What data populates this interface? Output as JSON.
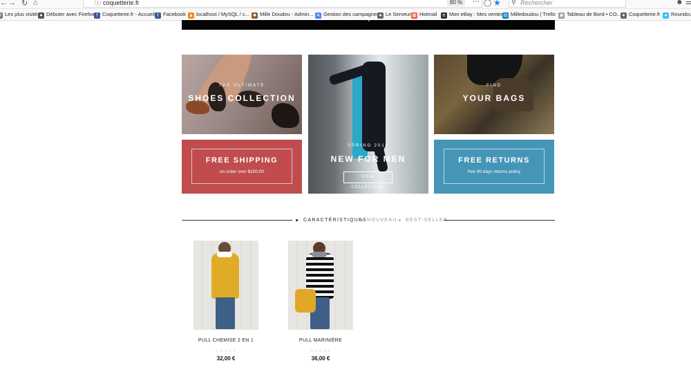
{
  "browser": {
    "url": "coquetterie.fr",
    "zoom": "80 %",
    "search_placeholder": "Rechercher",
    "bookmarks": [
      {
        "label": "Les plus visités",
        "icon": "gear-icon",
        "color": "#777777"
      },
      {
        "label": "Débuter avec Firefox",
        "icon": "firefox-icon",
        "color": "#555555"
      },
      {
        "label": "Coquetterie.fr - Accueil",
        "icon": "facebook-icon",
        "color": "#3b5998"
      },
      {
        "label": "Facebook",
        "icon": "facebook-icon",
        "color": "#3b5998"
      },
      {
        "label": "localhost / MySQL / c...",
        "icon": "phpmyadmin-icon",
        "color": "#f08c00"
      },
      {
        "label": "Mille Doudou - Admin...",
        "icon": "doudou-icon",
        "color": "#8b5a2b"
      },
      {
        "label": "Gestion des campagnes",
        "icon": "adwords-icon",
        "color": "#4285f4"
      },
      {
        "label": "Le Serveur",
        "icon": "globe-icon",
        "color": "#666666"
      },
      {
        "label": "Hotmail",
        "icon": "windows-icon",
        "color": "#f25022"
      },
      {
        "label": "Mon eBay : Mes ventes",
        "icon": "ebay-icon",
        "color": "#333333"
      },
      {
        "label": "Milledoudou | Trello",
        "icon": "trello-icon",
        "color": "#0079bf"
      },
      {
        "label": "Tableau de Bord • CO...",
        "icon": "dashboard-icon",
        "color": "#9a9a9a"
      },
      {
        "label": "Coquetterie.fr",
        "icon": "globe-icon",
        "color": "#666666"
      },
      {
        "label": "Roundcu",
        "icon": "roundcube-icon",
        "color": "#37beff"
      }
    ]
  },
  "tiles": {
    "shoes": {
      "small": "THE ULTIMATE",
      "title": "SHOES COLLECTION"
    },
    "men": {
      "small": "SPRING 2013",
      "title": "NEW FOR MEN",
      "button": "VIEW COLLECTION"
    },
    "bags": {
      "small": "FIND",
      "title": "YOUR BAGS"
    },
    "shipping": {
      "title": "FREE SHIPPING",
      "subtitle": "on order over $150.00"
    },
    "returns": {
      "title": "FREE RETURNS",
      "subtitle": "free 90 days returns policy"
    }
  },
  "tabs": [
    "CARACTÉRISTIQUES",
    "NOUVEAU",
    "BEST-SELLER"
  ],
  "products": [
    {
      "name": "PULL CHEMISE 2 EN 1",
      "rating": "☆☆☆☆☆",
      "price": "32,00 €"
    },
    {
      "name": "PULL MARINIÈRE",
      "rating": "☆☆☆☆☆",
      "price": "36,00 €"
    }
  ],
  "colors": {
    "shipping_bg": "#c04c4e",
    "returns_bg": "#4596b6",
    "accent_star": "#0a84ff"
  }
}
